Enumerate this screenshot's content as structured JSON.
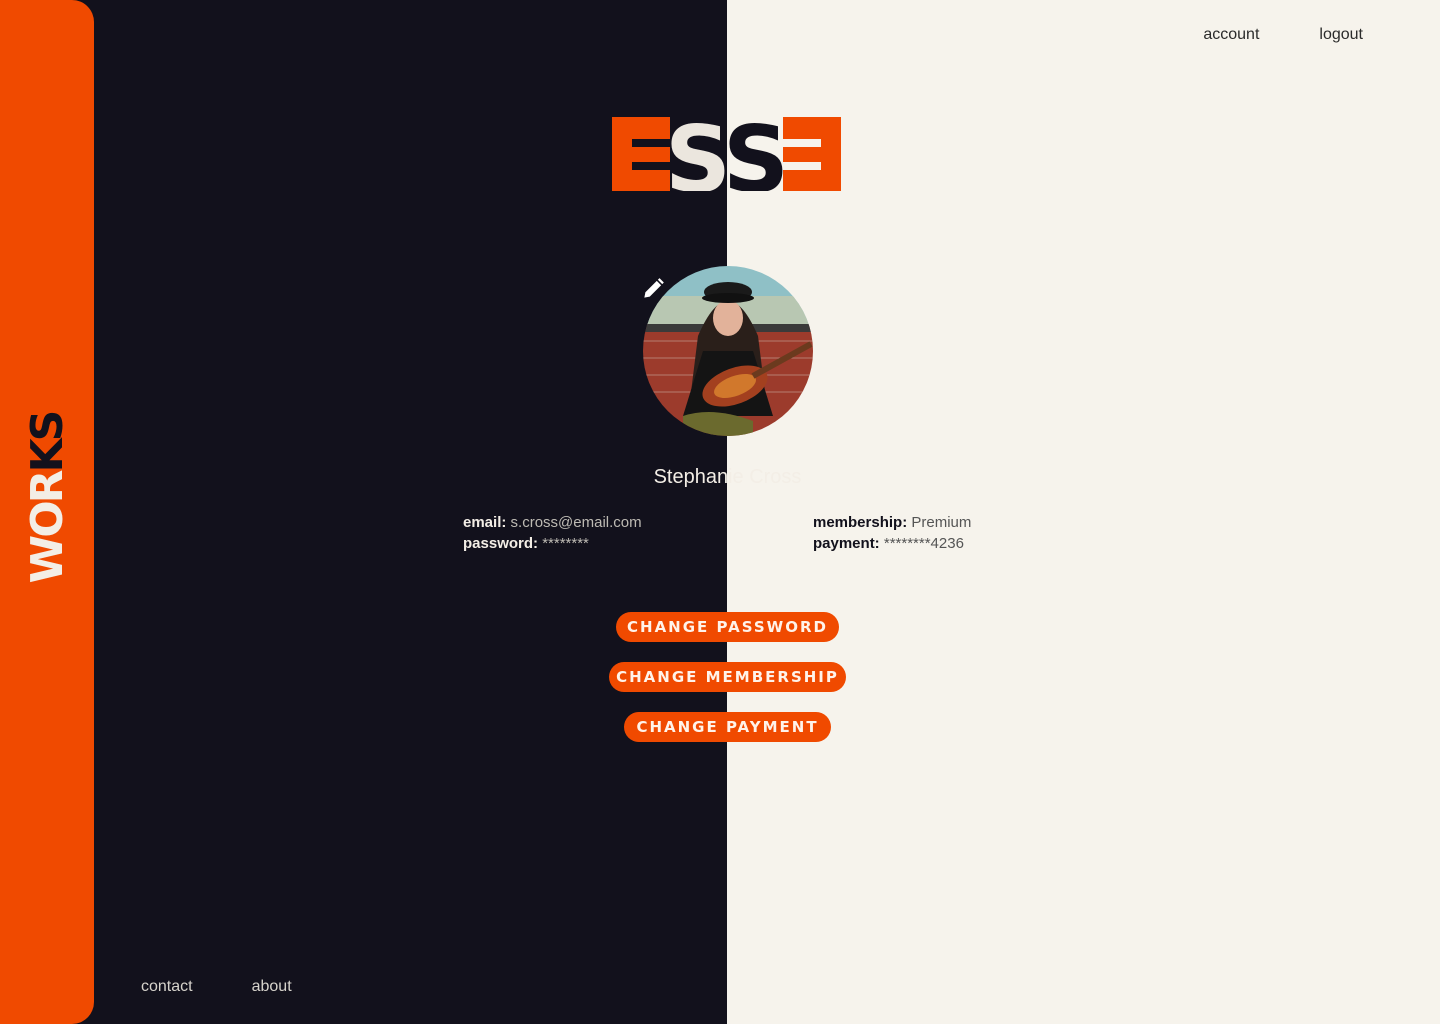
{
  "brand": {
    "logo_text": "ESSE",
    "sidebar_word_part1": "WOR",
    "sidebar_word_part2": "KS"
  },
  "top_nav": [
    {
      "label": "account"
    },
    {
      "label": "logout"
    }
  ],
  "bottom_nav": [
    {
      "label": "contact"
    },
    {
      "label": "about"
    }
  ],
  "profile": {
    "name": "Stephanie Cross",
    "email_label": "email:",
    "email_value": "s.cross@email.com",
    "password_label": "password:",
    "password_value": "********",
    "membership_label": "membership:",
    "membership_value": "Premium",
    "payment_label": "payment:",
    "payment_value": "********4236"
  },
  "actions": {
    "change_password": "CHANGE PASSWORD",
    "change_membership": "CHANGE MEMBERSHIP",
    "change_payment": "CHANGE PAYMENT"
  },
  "colors": {
    "accent": "#f04a00",
    "dark": "#12111c",
    "light": "#f6f3ec"
  },
  "icons": {
    "edit": "pencil-icon"
  }
}
